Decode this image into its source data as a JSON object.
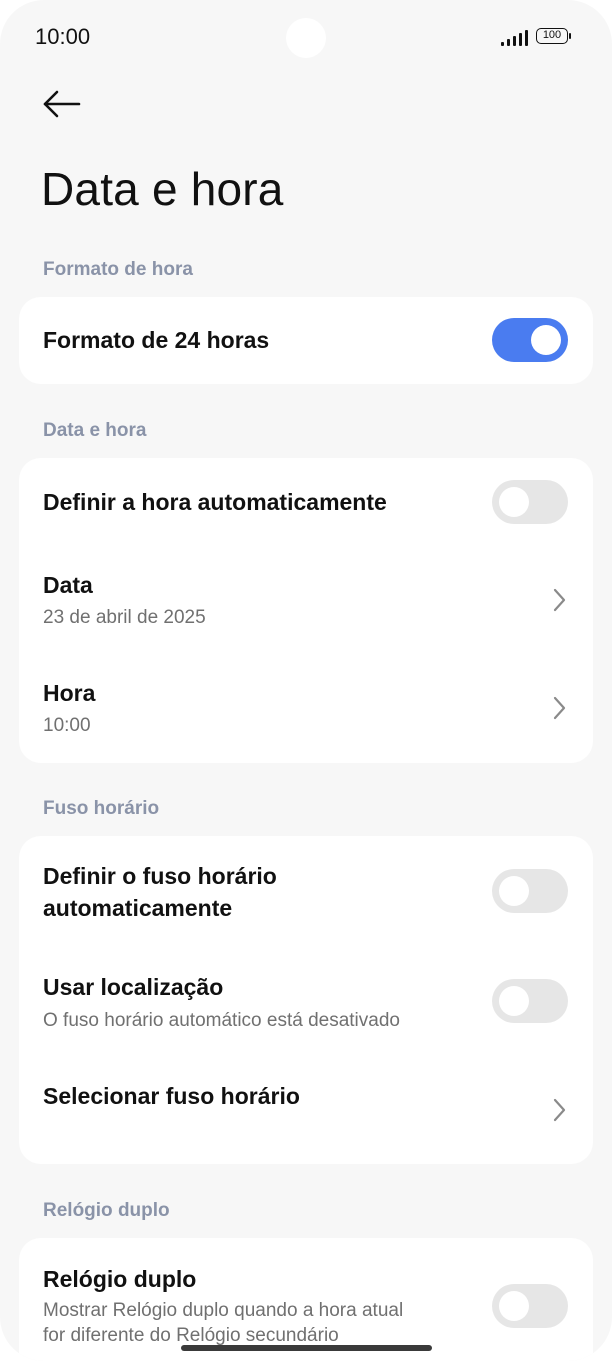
{
  "status_bar": {
    "time": "10:00",
    "battery": "100",
    "icons": [
      "signal-icon",
      "battery-icon"
    ]
  },
  "header": {
    "back_icon": "arrow-left-icon",
    "title": "Data e hora"
  },
  "sections": {
    "time_format": {
      "header": "Formato de hora",
      "rows": [
        {
          "title": "Formato de 24 horas",
          "toggle": true
        }
      ]
    },
    "date_time": {
      "header": "Data e hora",
      "rows": [
        {
          "title": "Definir a hora automaticamente",
          "toggle": false
        },
        {
          "title": "Data",
          "subtitle": "23 de abril de 2025",
          "icon": "chevron-right-icon"
        },
        {
          "title": "Hora",
          "subtitle": "10:00",
          "icon": "chevron-right-icon"
        }
      ]
    },
    "time_zone": {
      "header": "Fuso horário",
      "rows": [
        {
          "title_line1": "Definir o fuso horário",
          "title_line2": "automaticamente",
          "toggle": false
        },
        {
          "title": "Usar localização",
          "subtitle": "O fuso horário automático está desativado",
          "toggle": false
        },
        {
          "title": "Selecionar fuso horário",
          "icon": "chevron-right-icon"
        }
      ]
    },
    "dual_clock": {
      "header": "Relógio duplo",
      "rows": [
        {
          "title": "Relógio duplo",
          "subtitle_line1": "Mostrar Relógio duplo quando a hora atual",
          "subtitle_line2": "for diferente do Relógio secundário",
          "toggle": false
        }
      ]
    }
  },
  "colors": {
    "accent": "#4a7cf0",
    "background": "#f7f7f7",
    "card": "#ffffff",
    "section_header": "#8a93a8",
    "toggle_off": "#e6e6e6",
    "subtitle": "#707070"
  }
}
